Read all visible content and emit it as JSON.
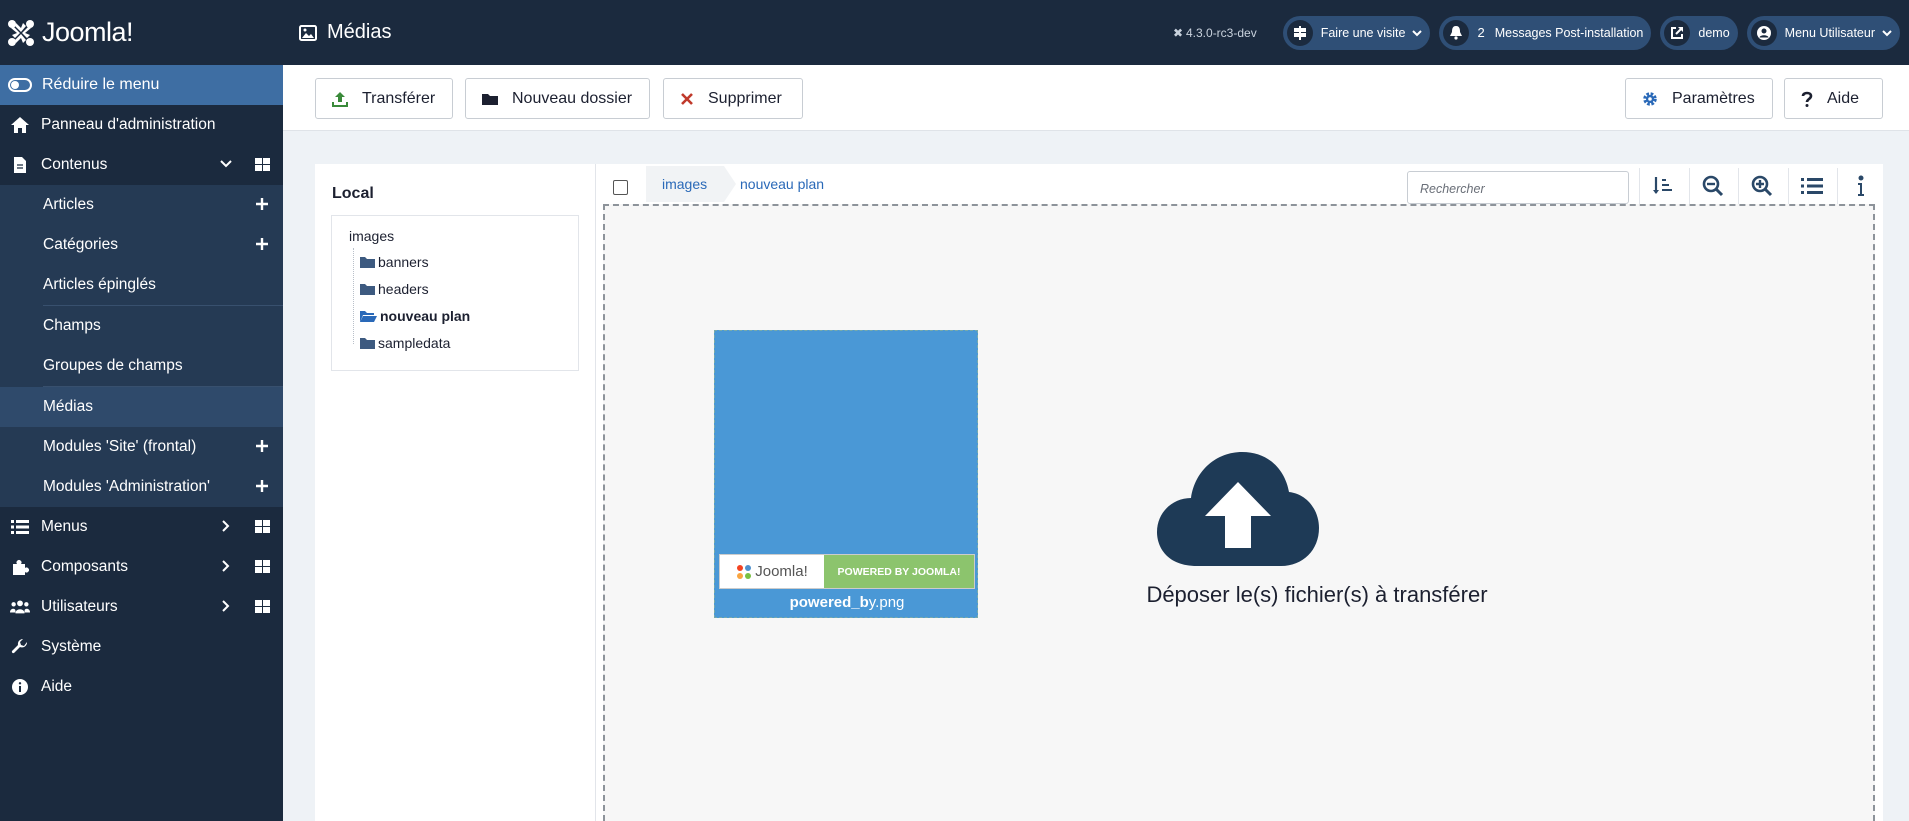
{
  "sidebar": {
    "logo": "Joomla!",
    "toggle": "Réduire le menu",
    "items": {
      "dashboard": "Panneau d'administration",
      "content": "Contenus",
      "articles": "Articles",
      "categories": "Catégories",
      "featured": "Articles épinglés",
      "fields": "Champs",
      "field_groups": "Groupes de champs",
      "media": "Médias",
      "site_modules": "Modules 'Site' (frontal)",
      "admin_modules": "Modules 'Administration'",
      "menus": "Menus",
      "components": "Composants",
      "users": "Utilisateurs",
      "system": "Système",
      "help": "Aide"
    }
  },
  "header": {
    "title": "Médias",
    "version": "4.3.0-rc3-dev",
    "tour": "Faire une visite",
    "messages_count": "2",
    "messages": "Messages Post-installation",
    "site": "demo",
    "user_menu": "Menu Utilisateur"
  },
  "toolbar": {
    "upload": "Transférer",
    "new_folder": "Nouveau dossier",
    "delete": "Supprimer",
    "options": "Paramètres",
    "help": "Aide"
  },
  "tree": {
    "title": "Local",
    "root": "images",
    "folders": [
      "banners",
      "headers",
      "nouveau plan",
      "sampledata"
    ],
    "active": "nouveau plan"
  },
  "browser": {
    "breadcrumb": [
      "images",
      "nouveau plan"
    ],
    "search_placeholder": "Rechercher",
    "file": {
      "name_bold": "powered_b",
      "name_rest": "y.png",
      "banner_logo": "Joomla!",
      "banner_text": "POWERED BY JOOMLA!"
    },
    "drop_text": "Déposer le(s) fichier(s) à transférer"
  },
  "colors": {
    "sidebar_bg": "#1b2a3e",
    "accent": "#3e6ea3",
    "card": "#4a98d6",
    "cloud": "#1e3a56",
    "link": "#2a69b8"
  }
}
